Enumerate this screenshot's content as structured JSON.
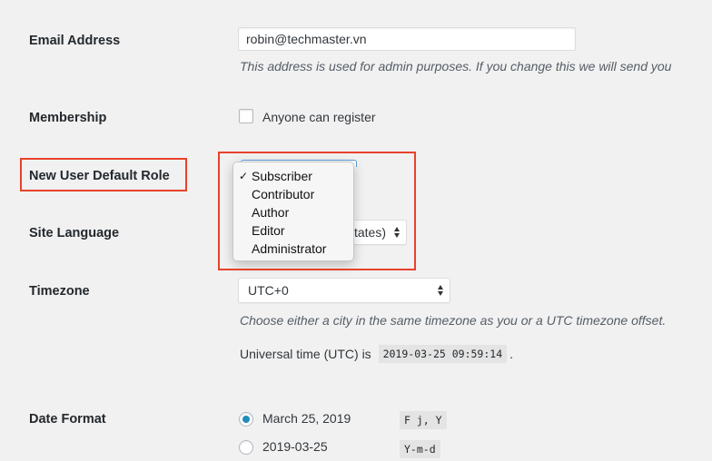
{
  "settings": {
    "email": {
      "label": "Email Address",
      "value": "robin@techmaster.vn",
      "description": "This address is used for admin purposes. If you change this we will send you"
    },
    "membership": {
      "label": "Membership",
      "checkbox_label": "Anyone can register",
      "checked": false
    },
    "default_role": {
      "label": "New User Default Role",
      "selected": "Subscriber",
      "options": [
        "Subscriber",
        "Contributor",
        "Author",
        "Editor",
        "Administrator"
      ]
    },
    "site_language": {
      "label": "Site Language",
      "visible_value": "tates)"
    },
    "timezone": {
      "label": "Timezone",
      "value": "UTC+0",
      "description": "Choose either a city in the same timezone as you or a UTC timezone offset.",
      "utc_prefix": "Universal time (UTC) is",
      "utc_time": "2019-03-25 09:59:14",
      "utc_suffix": "."
    },
    "date_format": {
      "label": "Date Format",
      "options": [
        {
          "label": "March 25, 2019",
          "format": "F j, Y",
          "checked": true
        },
        {
          "label": "2019-03-25",
          "format": "Y-m-d",
          "checked": false
        }
      ]
    }
  },
  "colors": {
    "highlight_border": "#e8412b",
    "radio_accent": "#1e8cbe",
    "focus_border": "#5b9dd9"
  },
  "icons": {
    "check": "checkmark-icon",
    "select_arrows": "select-arrows-icon"
  }
}
